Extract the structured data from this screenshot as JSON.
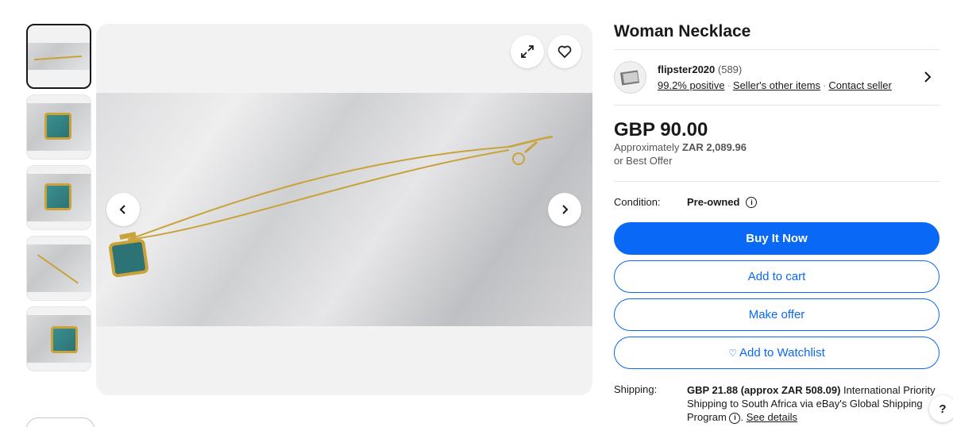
{
  "listing": {
    "title": "Woman Necklace"
  },
  "seller": {
    "name": "flipster2020",
    "feedback_count": "(589)",
    "positive": "99.2% positive",
    "other_items": "Seller's other items",
    "contact": "Contact seller"
  },
  "price": {
    "main": "GBP 90.00",
    "approx_prefix": "Approximately",
    "approx_value": "ZAR 2,089.96",
    "best_offer": "or Best Offer"
  },
  "condition": {
    "label": "Condition:",
    "value": "Pre-owned"
  },
  "actions": {
    "buy_now": "Buy It Now",
    "add_to_cart": "Add to cart",
    "make_offer": "Make offer",
    "add_to_watchlist": "Add to Watchlist"
  },
  "shipping": {
    "label": "Shipping:",
    "cost": "GBP 21.88 (approx ZAR 508.09)",
    "description": "International Priority Shipping to South Africa via eBay's Global Shipping Program",
    "see_details": "See details"
  },
  "help": {
    "label": "?"
  },
  "colors": {
    "primary_blue": "#0968f6",
    "text": "#191919",
    "gold": "#c9a23a",
    "stone_teal": "#2d7375"
  },
  "icons": [
    "expand-icon",
    "heart-icon",
    "chevron-left-icon",
    "chevron-right-icon",
    "info-icon",
    "question-icon"
  ]
}
